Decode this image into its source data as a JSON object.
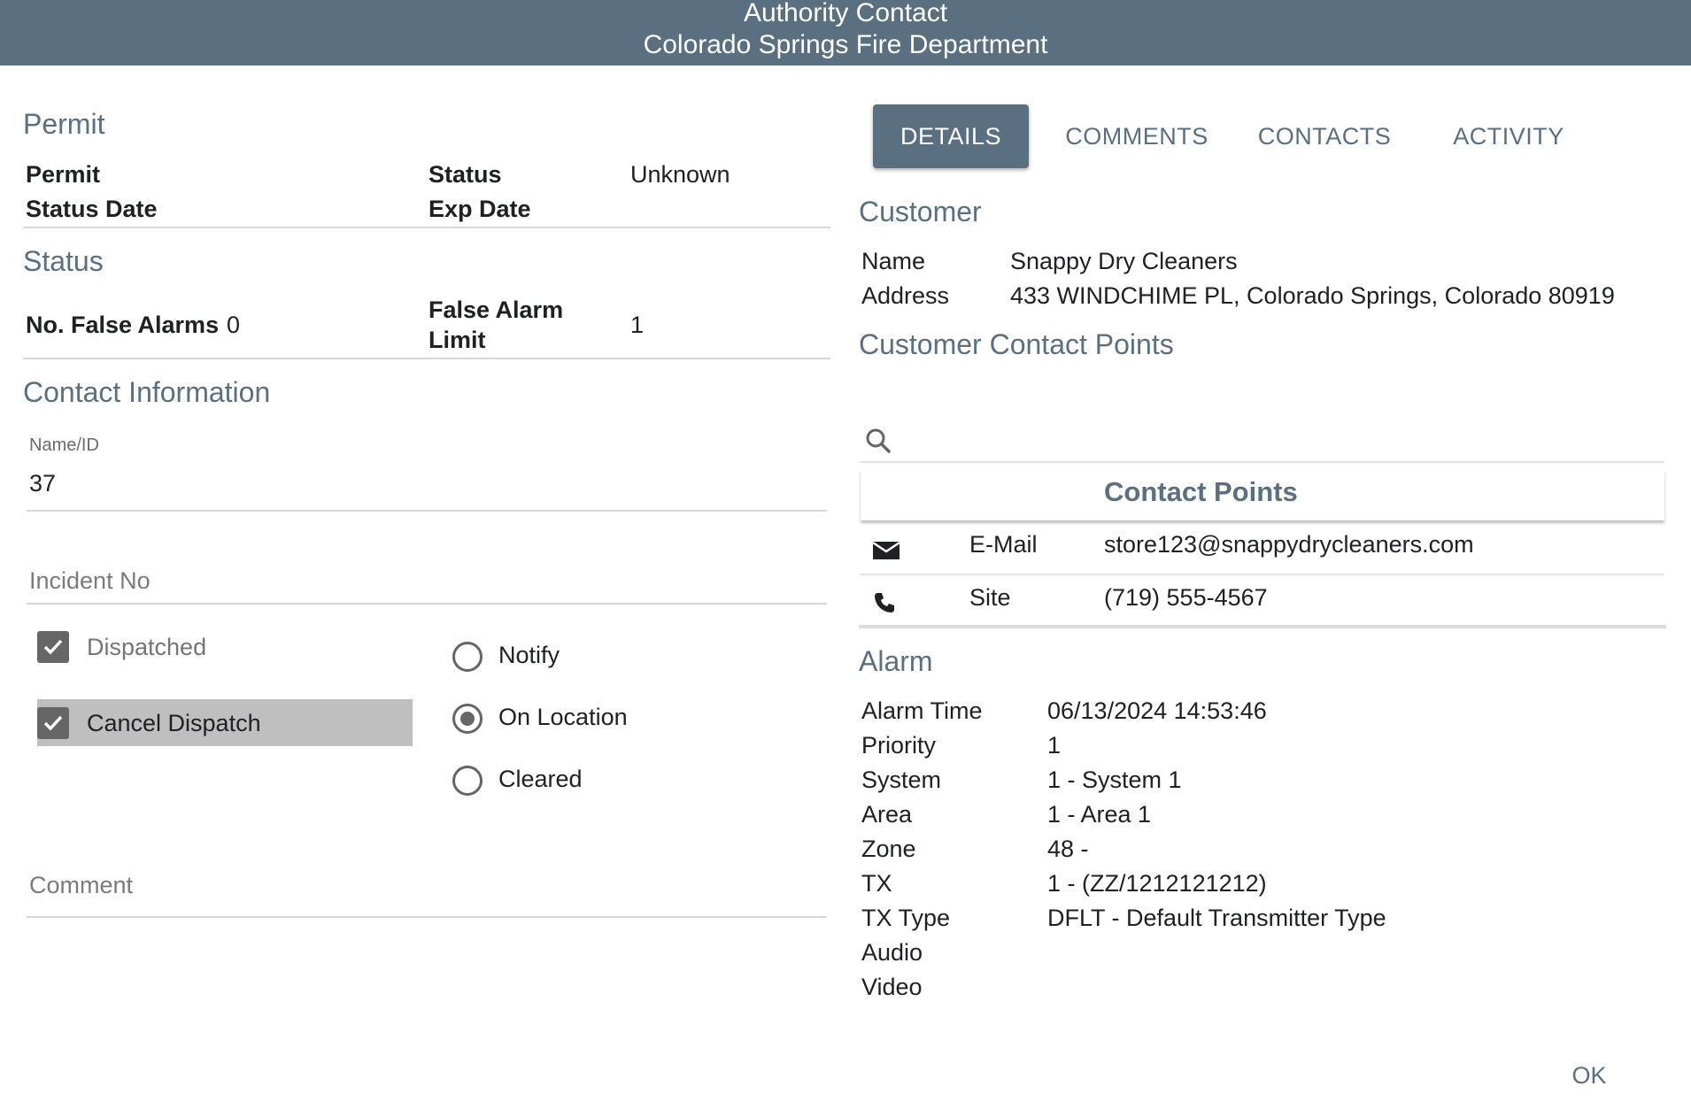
{
  "header": {
    "title": "Authority Contact",
    "subtitle": "Colorado Springs Fire Department"
  },
  "permit": {
    "heading": "Permit",
    "permit_label": "Permit",
    "status_date_label": "Status Date",
    "status_label": "Status",
    "status_value": "Unknown",
    "exp_date_label": "Exp Date"
  },
  "status": {
    "heading": "Status",
    "false_alarms_label": "No. False Alarms",
    "false_alarms_value": "0",
    "false_alarm_limit_label_line1": "False Alarm",
    "false_alarm_limit_label_line2": "Limit",
    "false_alarm_limit_value": "1"
  },
  "contact_info": {
    "heading": "Contact Information",
    "name_id_label": "Name/ID",
    "name_id_value": "37",
    "incident_placeholder": "Incident No",
    "dispatched_label": "Dispatched",
    "dispatched_checked": true,
    "cancel_dispatch_label": "Cancel Dispatch",
    "cancel_dispatch_checked": true,
    "radio_options": [
      "Notify",
      "On Location",
      "Cleared"
    ],
    "radio_selected": "On Location",
    "comment_placeholder": "Comment"
  },
  "tabs": [
    "DETAILS",
    "COMMENTS",
    "CONTACTS",
    "ACTIVITY"
  ],
  "active_tab": "DETAILS",
  "customer": {
    "heading": "Customer",
    "name_label": "Name",
    "name_value": "Snappy Dry Cleaners",
    "address_label": "Address",
    "address_value": "433 WINDCHIME PL, Colorado Springs, Colorado 80919"
  },
  "customer_contact_points": {
    "heading": "Customer Contact Points",
    "search_icon": "search-icon",
    "table_title": "Contact Points",
    "rows": [
      {
        "icon": "envelope-icon",
        "type": "E-Mail",
        "value": "store123@snappydrycleaners.com"
      },
      {
        "icon": "phone-icon",
        "type": "Site",
        "value": "(719) 555-4567"
      }
    ]
  },
  "alarm": {
    "heading": "Alarm",
    "rows": [
      {
        "label": "Alarm Time",
        "value": "06/13/2024 14:53:46"
      },
      {
        "label": "Priority",
        "value": "1"
      },
      {
        "label": "System",
        "value": "1 - System 1"
      },
      {
        "label": "Area",
        "value": "1 - Area 1"
      },
      {
        "label": "Zone",
        "value": "48 -"
      },
      {
        "label": "TX",
        "value": "1 - (ZZ/1212121212)"
      },
      {
        "label": "TX Type",
        "value": "DFLT - Default Transmitter Type"
      },
      {
        "label": "Audio",
        "value": ""
      },
      {
        "label": "Video",
        "value": ""
      }
    ]
  },
  "footer": {
    "ok_label": "OK"
  },
  "colors": {
    "accent": "#5a7080",
    "checkbox": "#666666",
    "cancel_bg": "#bfbfbf"
  }
}
